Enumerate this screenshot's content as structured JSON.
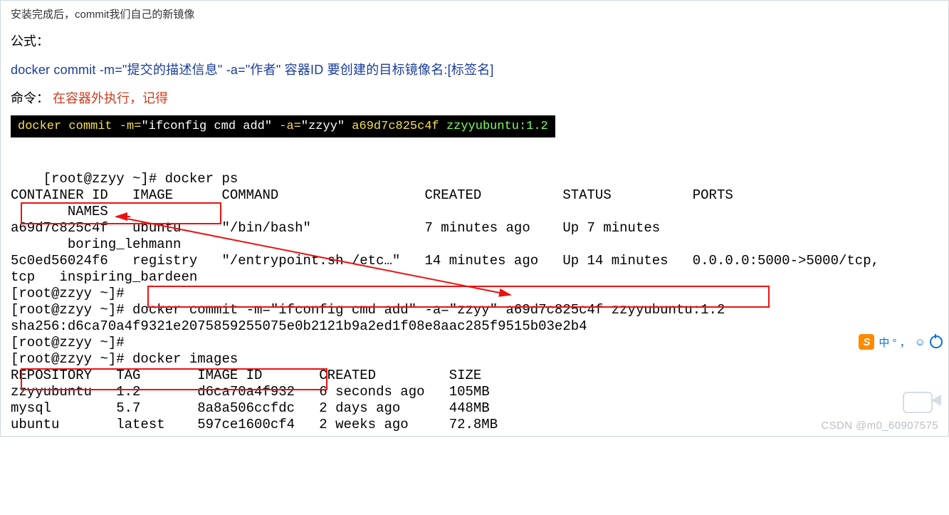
{
  "top_note": "安装完成后，commit我们自己的新镜像",
  "formula_label": "公式：",
  "formula_line": "docker commit -m=\"提交的描述信息\" -a=\"作者\" 容器ID 要创建的目标镜像名:[标签名]",
  "cmd_label": "命令：",
  "cmd_red": "在容器外执行，记得",
  "black_cmd": {
    "yellow": "docker commit -m=",
    "white1": "\"ifconfig cmd add\"",
    "yellow2": " -a=",
    "white2": "\"zzyy\"",
    "yellow3": " a69d7c825c4f ",
    "green": "zzyyubuntu:1.2"
  },
  "terminal": "[root@zzyy ~]# docker ps\nCONTAINER ID   IMAGE      COMMAND                  CREATED          STATUS          PORTS\n       NAMES\na69d7c825c4f   ubuntu     \"/bin/bash\"              7 minutes ago    Up 7 minutes\n       boring_lehmann\n5c0ed56024f6   registry   \"/entrypoint.sh /etc…\"   14 minutes ago   Up 14 minutes   0.0.0.0:5000->5000/tcp,\ntcp   inspiring_bardeen\n[root@zzyy ~]#\n[root@zzyy ~]# docker commit -m=\"ifconfig cmd add\" -a=\"zzyy\" a69d7c825c4f zzyyubuntu:1.2\nsha256:d6ca70a4f9321e2075859255075e0b2121b9a2ed1f08e8aac285f9515b03e2b4\n[root@zzyy ~]#\n[root@zzyy ~]# docker images\nREPOSITORY   TAG       IMAGE ID       CREATED         SIZE\nzzyyubuntu   1.2       d6ca70a4f932   6 seconds ago   105MB\nmysql        5.7       8a8a506ccfdc   2 days ago      448MB\nubuntu       latest    597ce1600cf4   2 weeks ago     72.8MB",
  "ime_text": "中  ° ，",
  "watermark": "CSDN @m0_60907575"
}
